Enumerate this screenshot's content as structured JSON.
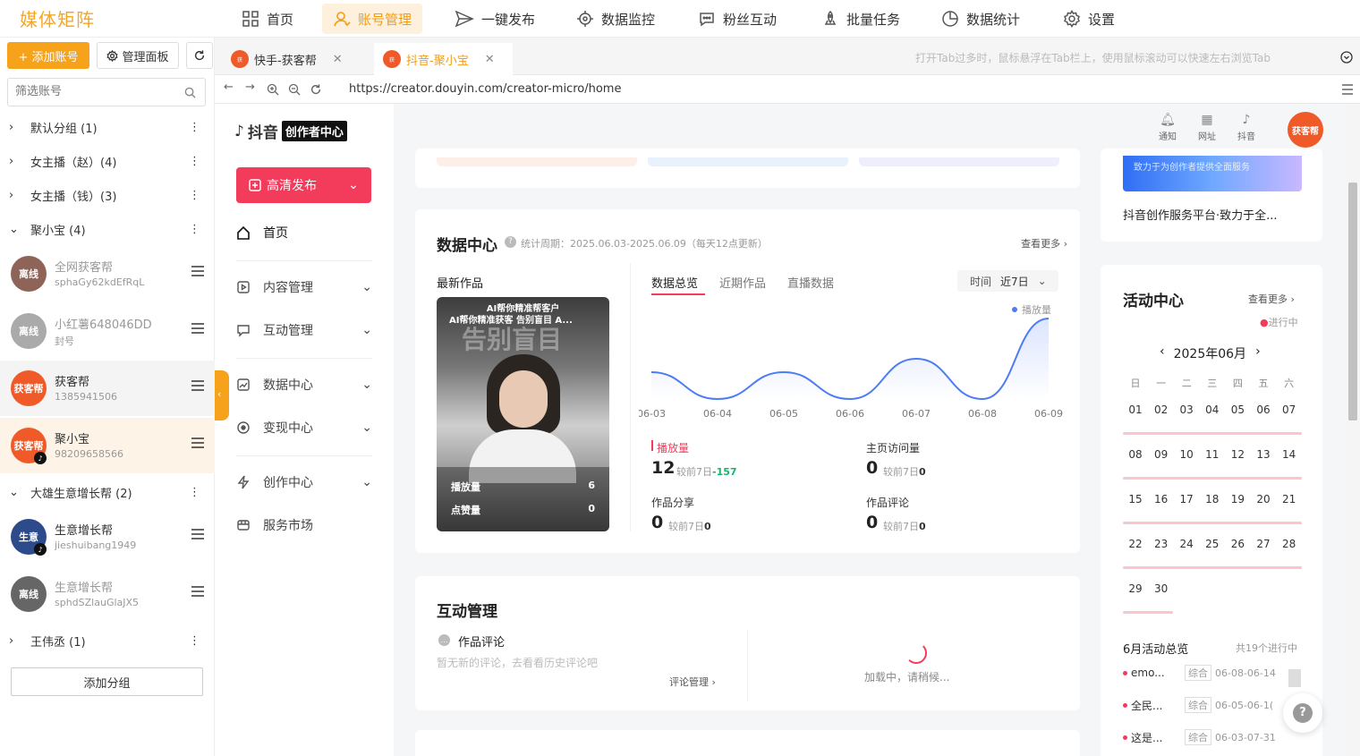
{
  "app": {
    "brand": "媒体矩阵"
  },
  "nav": [
    {
      "label": "首页",
      "icon": "grid-icon"
    },
    {
      "label": "账号管理",
      "icon": "user-icon",
      "active": true
    },
    {
      "label": "一键发布",
      "icon": "send-icon"
    },
    {
      "label": "数据监控",
      "icon": "target-icon"
    },
    {
      "label": "粉丝互动",
      "icon": "chat-icon"
    },
    {
      "label": "批量任务",
      "icon": "rocket-icon"
    },
    {
      "label": "数据统计",
      "icon": "pie-icon"
    },
    {
      "label": "设置",
      "icon": "gear-icon"
    }
  ],
  "sidebar": {
    "add_account": "+ 添加账号",
    "manage_panel": "管理面板",
    "filter_placeholder": "筛选账号",
    "add_group": "添加分组",
    "groups": [
      {
        "label": "默认分组 (1)"
      },
      {
        "label": "女主播（赵）(4)"
      },
      {
        "label": "女主播（钱）(3)"
      },
      {
        "label": "聚小宝 (4)"
      },
      {
        "label": "大雄生意增长帮 (2)"
      },
      {
        "label": "王伟丞 (1)"
      }
    ],
    "accounts": [
      {
        "name": "全网获客帮",
        "sub": "sphaGy62kdEfRqL",
        "avatar_text": "离线",
        "offline": true
      },
      {
        "name": "小红薯648046DD",
        "sub": "封号",
        "avatar_text": "离线",
        "offline": true
      },
      {
        "name": "获客帮",
        "sub": "1385941506",
        "avatar_text": "获客帮"
      },
      {
        "name": "聚小宝",
        "sub": "98209658566",
        "avatar_text": "获客帮"
      },
      {
        "name": "生意增长帮",
        "sub": "jieshuibang1949",
        "avatar_text": "生意"
      },
      {
        "name": "生意增长帮",
        "sub": "sphdSZlauGlaJX5",
        "avatar_text": "离线",
        "offline": true
      }
    ]
  },
  "tabs": [
    {
      "label": "快手-获客帮"
    },
    {
      "label": "抖音-聚小宝",
      "active": true
    }
  ],
  "tab_hint": "打开Tab过多时，鼠标悬浮在Tab栏上，使用鼠标滚动可以快速左右浏览Tab",
  "address": {
    "url": "https://creator.douyin.com/creator-micro/home"
  },
  "douyin": {
    "logo_text": "抖音",
    "logo_box": "创作者中心",
    "publish": "高清发布",
    "menu": [
      "首页",
      "内容管理",
      "互动管理",
      "数据中心",
      "变现中心",
      "创作中心",
      "服务市场"
    ],
    "top_icons": [
      "通知",
      "网址",
      "抖音"
    ],
    "user_avatar": "获客帮",
    "data_center": {
      "title": "数据中心",
      "period": "统计周期：2025.06.03-2025.06.09（每天12点更新）",
      "more": "查看更多",
      "latest_title": "最新作品",
      "video_caption_top": "AI帮你精准帮客户",
      "video_caption": "AI帮你精准获客 告别盲目 A...",
      "video_overlay": "告别盲目",
      "play_label": "播放量",
      "play_value": "6",
      "like_label": "点赞量",
      "like_value": "0",
      "tabs": [
        "数据总览",
        "近期作品",
        "直播数据"
      ],
      "time_label": "时间",
      "time_value": "近7日",
      "legend": "播放量",
      "metrics": [
        {
          "label": "播放量",
          "value": "12",
          "cmp": "较前7日",
          "delta": "-157"
        },
        {
          "label": "主页访问量",
          "value": "0",
          "cmp": "较前7日",
          "delta": "0"
        },
        {
          "label": "作品分享",
          "value": "0",
          "cmp": "较前7日",
          "delta": "0"
        },
        {
          "label": "作品评论",
          "value": "0",
          "cmp": "较前7日",
          "delta": "0"
        }
      ]
    },
    "interaction": {
      "title": "互动管理",
      "comments_label": "作品评论",
      "empty_text": "暂无新的评论，去看看历史评论吧",
      "manage_link": "评论管理",
      "loading": "加载中，请稍候..."
    },
    "banner_text": "致力于为创作者提供全面服务",
    "platform_text": "抖音创作服务平台·致力于全...",
    "activity": {
      "title": "活动中心",
      "more": "查看更多",
      "status": "进行中",
      "month": "2025年06月",
      "weekdays": [
        "日",
        "一",
        "二",
        "三",
        "四",
        "五",
        "六"
      ],
      "weeks": [
        [
          "01",
          "02",
          "03",
          "04",
          "05",
          "06",
          "07"
        ],
        [
          "08",
          "09",
          "10",
          "11",
          "12",
          "13",
          "14"
        ],
        [
          "15",
          "16",
          "17",
          "18",
          "19",
          "20",
          "21"
        ],
        [
          "22",
          "23",
          "24",
          "25",
          "26",
          "27",
          "28"
        ],
        [
          "29",
          "30"
        ]
      ],
      "overview_title": "6月活动总览",
      "overview_count": "共19个进行中",
      "items": [
        {
          "name": "emo...",
          "tag": "综合",
          "date": "06-08-06-14"
        },
        {
          "name": "全民...",
          "tag": "综合",
          "date": "06-05-06-1("
        },
        {
          "name": "这是...",
          "tag": "综合",
          "date": "06-03-07-31"
        }
      ]
    }
  },
  "chart_data": {
    "type": "line",
    "categories": [
      "06-03",
      "06-04",
      "06-05",
      "06-06",
      "06-07",
      "06-08",
      "06-09"
    ],
    "series": [
      {
        "name": "播放量",
        "values": [
          2,
          0,
          2,
          0,
          3,
          0,
          6
        ]
      }
    ],
    "title": "",
    "xlabel": "",
    "ylabel": "",
    "legend": "top-right",
    "grid": false,
    "color": "#4e7cf5"
  },
  "colors": {
    "accent": "#f39c12",
    "douyin_red": "#f33b5c",
    "line": "#4e7cf5"
  }
}
